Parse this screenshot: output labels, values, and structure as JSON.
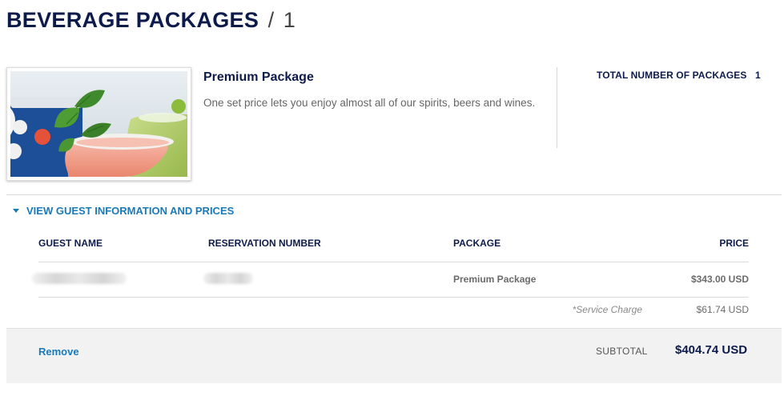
{
  "header": {
    "title": "BEVERAGE PACKAGES",
    "separator": "/",
    "count": "1"
  },
  "package": {
    "image_icon": "beverage-cocktail-image",
    "name": "Premium Package",
    "description": "One set price lets you enjoy almost all of our spirits, beers and wines.",
    "total_label": "TOTAL NUMBER OF PACKAGES",
    "total_value": "1"
  },
  "details": {
    "toggle_icon": "caret-down-icon",
    "toggle_label": "VIEW GUEST INFORMATION AND PRICES",
    "columns": {
      "guest_name": "GUEST NAME",
      "reservation_number": "RESERVATION NUMBER",
      "package": "PACKAGE",
      "price": "PRICE"
    },
    "rows": [
      {
        "guest_name": "",
        "reservation_number": "",
        "package": "Premium Package",
        "price": "$343.00 USD"
      }
    ],
    "service_charge_label": "*Service Charge",
    "service_charge_value": "$61.74 USD"
  },
  "footer": {
    "remove_label": "Remove",
    "subtotal_label": "SUBTOTAL",
    "subtotal_value": "$404.74 USD"
  },
  "colors": {
    "navy": "#0d1b4b",
    "link_blue": "#1a7ab8",
    "footer_bg": "#f2f2f2"
  }
}
